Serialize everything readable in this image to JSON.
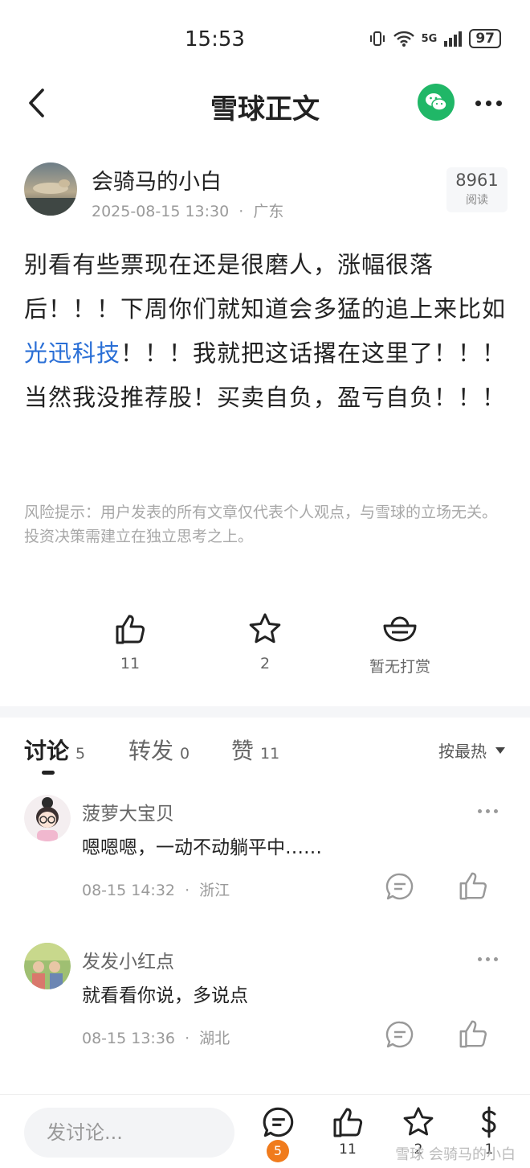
{
  "status_bar": {
    "time": "15:53",
    "network": "5G",
    "battery": "97"
  },
  "nav": {
    "title": "雪球正文"
  },
  "post": {
    "author": "会骑马的小白",
    "date": "2025-08-15 13:30",
    "location": "广东",
    "meta_sep": "·",
    "views_count": "8961",
    "views_label": "阅读",
    "body_before": "别看有些票现在还是很磨人，涨幅很落后！！！下周你们就知道会多猛的追上来比如",
    "stock_link": "光迅科技",
    "body_after": "！！！我就把这话撂在这里了！！！当然我没推荐股！买卖自负，盈亏自负！！！",
    "risk_notice": "风险提示：用户发表的所有文章仅代表个人观点，与雪球的立场无关。投资决策需建立在独立思考之上。"
  },
  "actions": {
    "like_count": "11",
    "favorite_count": "2",
    "reward_label": "暂无打赏"
  },
  "tabs": [
    {
      "label": "讨论",
      "count": "5"
    },
    {
      "label": "转发",
      "count": "0"
    },
    {
      "label": "赞",
      "count": "11"
    }
  ],
  "sort_label": "按最热",
  "comments": [
    {
      "name": "菠萝大宝贝",
      "text": "嗯嗯嗯，一动不动躺平中……",
      "time": "08-15 14:32",
      "location": "浙江"
    },
    {
      "name": "发发小红点",
      "text": "就看看你说，多说点",
      "time": "08-15 13:36",
      "location": "湖北"
    }
  ],
  "bottom_bar": {
    "input_placeholder": "发讨论...",
    "comment_badge": "5",
    "like_count": "11",
    "favorite_count": "2",
    "reward_count": "1",
    "watermark": "雪球 会骑马的小白"
  },
  "colors": {
    "accent_green": "#20b767",
    "link_blue": "#2a6fd6",
    "badge_orange": "#f07b1c"
  }
}
